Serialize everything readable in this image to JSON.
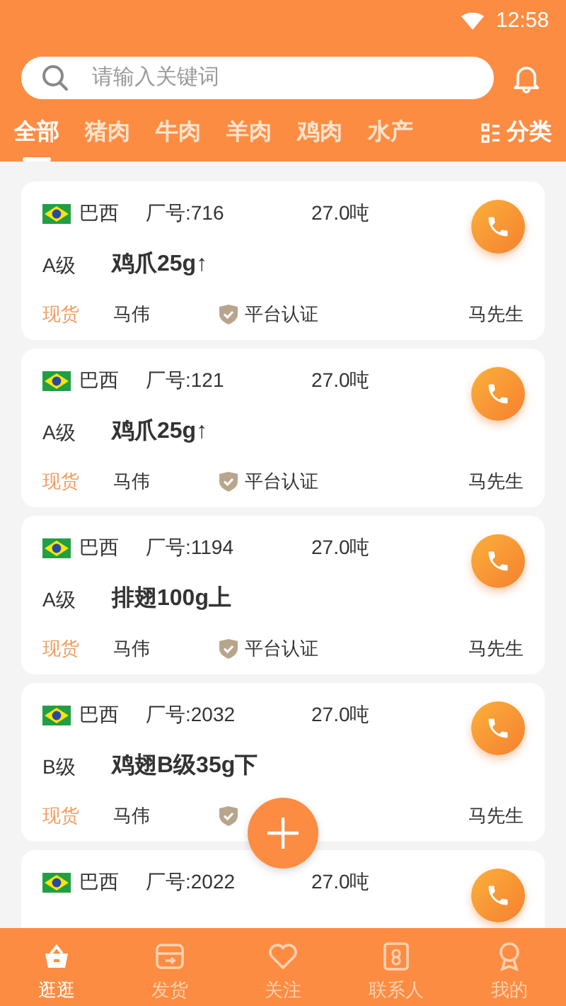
{
  "status_bar": {
    "time": "12:58"
  },
  "search": {
    "placeholder": "请输入关键词"
  },
  "tabs": [
    {
      "label": "全部",
      "selected": true
    },
    {
      "label": "猪肉",
      "selected": false
    },
    {
      "label": "牛肉",
      "selected": false
    },
    {
      "label": "羊肉",
      "selected": false
    },
    {
      "label": "鸡肉",
      "selected": false
    },
    {
      "label": "水产",
      "selected": false
    }
  ],
  "category_button": "分类",
  "listings": [
    {
      "country": "巴西",
      "factory": "厂号:716",
      "weight": "27.0吨",
      "grade": "A级",
      "product": "鸡爪25g↑",
      "stock": "现货",
      "seller": "马伟",
      "certification": "平台认证",
      "contact": "马先生"
    },
    {
      "country": "巴西",
      "factory": "厂号:121",
      "weight": "27.0吨",
      "grade": "A级",
      "product": "鸡爪25g↑",
      "stock": "现货",
      "seller": "马伟",
      "certification": "平台认证",
      "contact": "马先生"
    },
    {
      "country": "巴西",
      "factory": "厂号:1194",
      "weight": "27.0吨",
      "grade": "A级",
      "product": "排翅100g上",
      "stock": "现货",
      "seller": "马伟",
      "certification": "平台认证",
      "contact": "马先生"
    },
    {
      "country": "巴西",
      "factory": "厂号:2032",
      "weight": "27.0吨",
      "grade": "B级",
      "product": "鸡翅B级35g下",
      "stock": "现货",
      "seller": "马伟",
      "contact": "马先生"
    },
    {
      "country": "巴西",
      "factory": "厂号:2022",
      "weight": "27.0吨"
    }
  ],
  "bottom_nav": [
    {
      "label": "逛逛",
      "selected": true
    },
    {
      "label": "发货",
      "selected": false
    },
    {
      "label": "关注",
      "selected": false
    },
    {
      "label": "联系人",
      "selected": false
    },
    {
      "label": "我的",
      "selected": false
    }
  ]
}
